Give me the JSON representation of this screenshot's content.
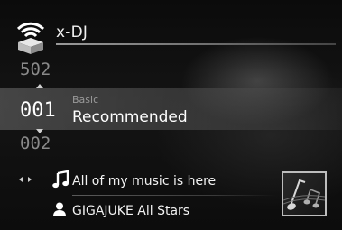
{
  "header": {
    "app_title": "x-DJ",
    "icon": "wifi-signal-icon"
  },
  "channels": {
    "previous_number": "502",
    "current_number": "001",
    "next_number": "002",
    "current_category": "Basic",
    "current_name": "Recommended"
  },
  "now_playing": {
    "nav_icon": "left-right-arrows-icon",
    "track_icon": "music-note-icon",
    "track_title": "All of my music is here",
    "artist_icon": "person-icon",
    "artist": "GIGAJUKE All Stars",
    "album_art_icon": "music-notes-art"
  },
  "colors": {
    "background": "#0d0d0d",
    "selected_band": "#6e6e6e",
    "text_primary": "#ffffff",
    "text_secondary": "#8a8a8a"
  }
}
